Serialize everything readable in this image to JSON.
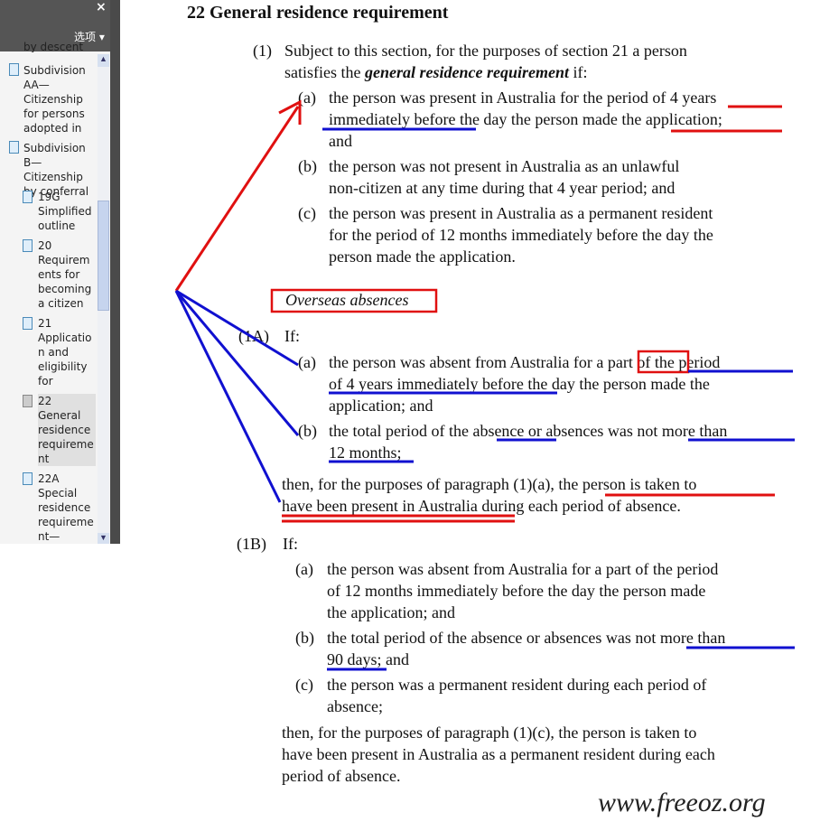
{
  "sidebar": {
    "close": "×",
    "options": "选项 ▾",
    "items": [
      "by descent",
      "Subdivision AA—Citizenship for persons adopted in",
      "Subdivision B—Citizenship by conferral",
      "19G Simplified outline",
      "20 Requirements for becoming a citizen",
      "21 Application and eligibility for",
      "22 General residence requirement",
      "22A Special residence requirement—"
    ]
  },
  "doc": {
    "heading": "22  General residence requirement",
    "s1": {
      "num": "(1)",
      "l1": "Subject to this section, for the purposes of section 21 a person",
      "l2a": "satisfies the ",
      "l2b": "general residence requirement",
      "l2c": " if:",
      "a": {
        "num": "(a)",
        "lines": [
          "the person was present in Australia for the period of 4 years",
          "immediately before the day the person made the application;",
          "and"
        ]
      },
      "b": {
        "num": "(b)",
        "lines": [
          "the person was not present in Australia as an unlawful",
          "non-citizen at any time during that 4 year period; and"
        ]
      },
      "c": {
        "num": "(c)",
        "lines": [
          "the person was present in Australia as a permanent resident",
          "for the period of 12 months immediately before the day the",
          "person made the application."
        ]
      }
    },
    "overseas": "Overseas absences",
    "s1A": {
      "num": "(1A)",
      "if": "If:",
      "a": {
        "num": "(a)",
        "lines": [
          "the person was absent from Australia for a part of the period",
          "of 4 years immediately before the day the person made the",
          "application; and"
        ]
      },
      "b": {
        "num": "(b)",
        "lines": [
          "the total period of the absence or absences was not more than",
          "12 months;"
        ]
      },
      "then": [
        "then, for the purposes of paragraph (1)(a), the person is taken to",
        "have been present in Australia during each period of absence."
      ]
    },
    "s1B": {
      "num": "(1B)",
      "if": "If:",
      "a": {
        "num": "(a)",
        "lines": [
          "the person was absent from Australia for a part of the period",
          "of 12 months immediately before the day the person made",
          "the application; and"
        ]
      },
      "b": {
        "num": "(b)",
        "lines": [
          "the total period of the absence or absences was not more than",
          "90 days; and"
        ]
      },
      "c": {
        "num": "(c)",
        "lines": [
          "the person was a permanent resident during each period of",
          "absence;"
        ]
      },
      "then": [
        "then, for the purposes of paragraph (1)(c), the person is taken to",
        "have been present in Australia as a permanent resident during each",
        "period of absence."
      ]
    }
  },
  "watermark": "www.freeoz.org",
  "annotation_colors": {
    "red": "#e01010",
    "blue": "#1010d0"
  }
}
